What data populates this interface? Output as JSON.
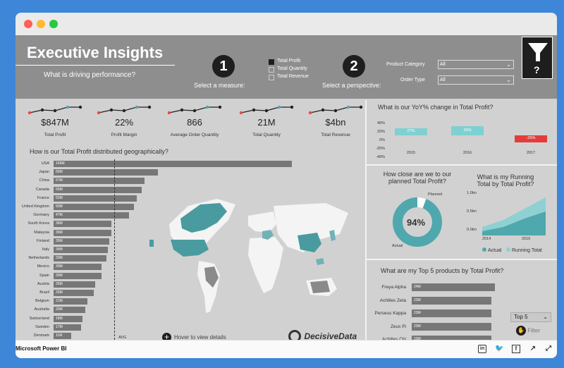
{
  "header": {
    "title": "Executive Insights",
    "subtitle": "What is driving performance?",
    "step1": "1",
    "step1_label": "Select a measure:",
    "step2": "2",
    "step2_label": "Select a perspective:",
    "measures": [
      "Total Profit",
      "Total Quantity",
      "Total Revenue"
    ],
    "product_category_label": "Product Category",
    "product_category_value": "All",
    "order_type_label": "Order Type",
    "order_type_value": "All",
    "filter_symbol": "?"
  },
  "kpis": [
    {
      "value": "$847M",
      "label": "Total Profit"
    },
    {
      "value": "22%",
      "label": "Profit Margin"
    },
    {
      "value": "866",
      "label": "Average Order Quantity"
    },
    {
      "value": "21M",
      "label": "Total Quantity"
    },
    {
      "value": "$4bn",
      "label": "Total Revenue"
    }
  ],
  "geo": {
    "title": "How is our Total Profit distributed geographically?",
    "avg_label": "AVG",
    "hover_hint": "Hover to view details",
    "brand": "DecisiveData",
    "brand_tag": "insights for decisions"
  },
  "chart_data": [
    {
      "type": "bar",
      "title": "How is our Total Profit distributed geographically?",
      "categories": [
        "USA",
        "Japan",
        "China",
        "Canada",
        "France",
        "United Kingdom",
        "Germany",
        "South Korea",
        "Malaysia",
        "Finland",
        "Italy",
        "Netherlands",
        "Mexico",
        "Spain",
        "Austria",
        "Brazil",
        "Belgium",
        "Australia",
        "Switzerland",
        "Sweden",
        "Denmark"
      ],
      "values": [
        149,
        65,
        57,
        55,
        52,
        50,
        47,
        36,
        36,
        35,
        34,
        33,
        30,
        30,
        26,
        25,
        21,
        20,
        18,
        17,
        11
      ],
      "labels": [
        "149M",
        "65M",
        "57M",
        "55M",
        "52M",
        "50M",
        "47M",
        "36M",
        "36M",
        "35M",
        "34M",
        "33M",
        "30M",
        "30M",
        "26M",
        "25M",
        "21M",
        "20M",
        "18M",
        "17M",
        "11M"
      ]
    },
    {
      "type": "bar",
      "title": "What is our YoY% change in Total Profit?",
      "categories": [
        "2015",
        "2016",
        "2017"
      ],
      "values": [
        27,
        33,
        -25
      ],
      "labels": [
        "27%",
        "33%",
        "-25%"
      ],
      "yticks": [
        "40%",
        "20%",
        "0%",
        "-20%",
        "-40%"
      ],
      "ylim": [
        -40,
        40
      ]
    },
    {
      "type": "pie",
      "title": "How close are we to our planned Total Profit?",
      "center_label": "94%",
      "slices": [
        {
          "name": "Actual",
          "value": 94
        },
        {
          "name": "Planned",
          "value": 6
        }
      ]
    },
    {
      "type": "area",
      "title": "What is my Running Total by Total Profit?",
      "yticks": [
        "1.0bn",
        "0.5bn",
        "0.0bn"
      ],
      "xticks": [
        "2014",
        "2016"
      ],
      "series": [
        {
          "name": "Actual"
        },
        {
          "name": "Running Total"
        }
      ]
    },
    {
      "type": "bar",
      "title": "What are my Top 5 products by Total Profit?",
      "categories": [
        "Freya Alpha",
        "Achilles Zeta",
        "Perseus Kappa",
        "Zeus Pi",
        "Achilles Chi"
      ],
      "values": [
        24,
        23,
        23,
        23,
        23
      ],
      "labels": [
        "24M",
        "23M",
        "23M",
        "23M",
        "23M"
      ]
    }
  ],
  "top5": {
    "dropdown": "Top 5",
    "filter_label": "Filter"
  },
  "legend_colors": {
    "actual": "#4fa8ad",
    "running": "#8fd0d3"
  },
  "footer": {
    "app": "Microsoft Power BI"
  }
}
